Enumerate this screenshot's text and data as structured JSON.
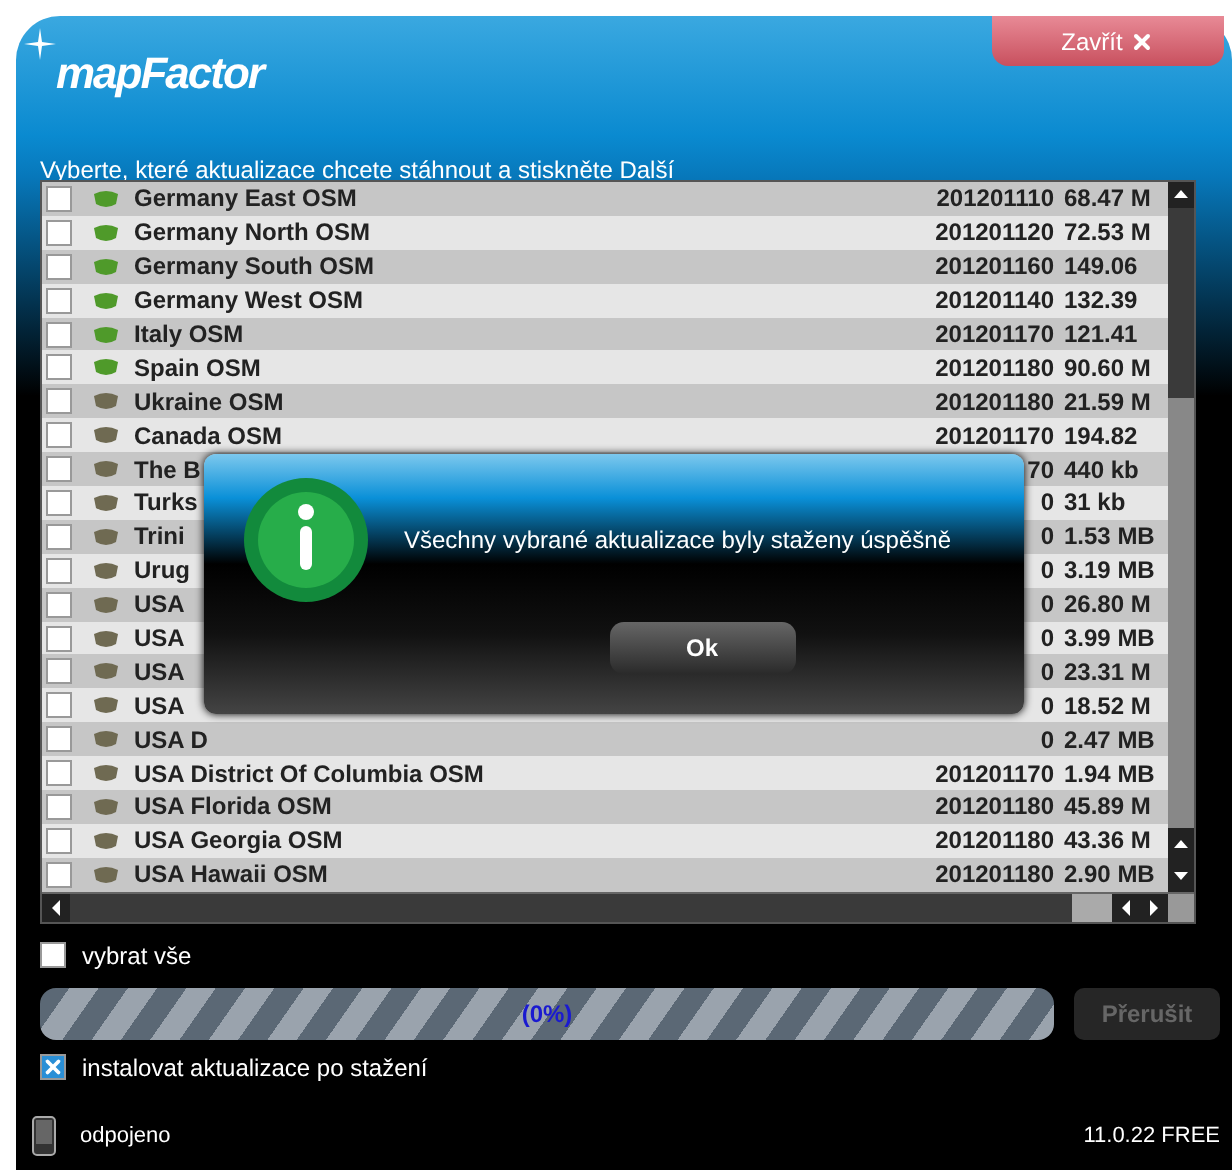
{
  "header": {
    "logo": "mapFactor",
    "close_button": "Zavřít",
    "instruction": "Vyberte, které aktualizace chcete stáhnout a stiskněte Další"
  },
  "updates": [
    {
      "name": "Germany East OSM",
      "date": "201201110",
      "size": "68.47 M",
      "checked": false,
      "installed": true
    },
    {
      "name": "Germany North OSM",
      "date": "201201120",
      "size": "72.53 M",
      "checked": false,
      "installed": true
    },
    {
      "name": "Germany South OSM",
      "date": "201201160",
      "size": "149.06",
      "checked": false,
      "installed": true
    },
    {
      "name": "Germany West OSM",
      "date": "201201140",
      "size": "132.39",
      "checked": false,
      "installed": true
    },
    {
      "name": "Italy OSM",
      "date": "201201170",
      "size": "121.41",
      "checked": false,
      "installed": true
    },
    {
      "name": "Spain OSM",
      "date": "201201180",
      "size": "90.60 M",
      "checked": false,
      "installed": true
    },
    {
      "name": "Ukraine OSM",
      "date": "201201180",
      "size": "21.59 M",
      "checked": false,
      "installed": false
    },
    {
      "name": "Canada OSM",
      "date": "201201170",
      "size": "194.82",
      "checked": false,
      "installed": false
    },
    {
      "name": "The B",
      "date": "70",
      "size": "440 kb",
      "checked": false,
      "installed": false
    },
    {
      "name": "Turks",
      "date": "0",
      "size": "31 kb",
      "checked": false,
      "installed": false
    },
    {
      "name": "Trini",
      "date": "0",
      "size": "1.53 MB",
      "checked": false,
      "installed": false
    },
    {
      "name": "Urug",
      "date": "0",
      "size": "3.19 MB",
      "checked": false,
      "installed": false
    },
    {
      "name": "USA",
      "date": "0",
      "size": "26.80 M",
      "checked": false,
      "installed": false
    },
    {
      "name": "USA",
      "date": "0",
      "size": "3.99 MB",
      "checked": false,
      "installed": false
    },
    {
      "name": "USA",
      "date": "0",
      "size": "23.31 M",
      "checked": false,
      "installed": false
    },
    {
      "name": "USA",
      "date": "0",
      "size": "18.52 M",
      "checked": false,
      "installed": false
    },
    {
      "name": "USA D",
      "date": "0",
      "size": "2.47 MB",
      "checked": false,
      "installed": false
    },
    {
      "name": "USA District Of Columbia OSM",
      "date": "201201170",
      "size": "1.94 MB",
      "checked": false,
      "installed": false
    },
    {
      "name": "USA Florida OSM",
      "date": "201201180",
      "size": "45.89 M",
      "checked": false,
      "installed": false
    },
    {
      "name": "USA Georgia OSM",
      "date": "201201180",
      "size": "43.36 M",
      "checked": false,
      "installed": false
    },
    {
      "name": "USA Hawaii OSM",
      "date": "201201180",
      "size": "2.90 MB",
      "checked": false,
      "installed": false
    }
  ],
  "select_all": {
    "label": "vybrat vše",
    "checked": false
  },
  "progress": {
    "level": 0,
    "reading": "(0%)"
  },
  "cancel_button": {
    "label": "Přerušit",
    "disabled": true
  },
  "install_after": {
    "label": "instalovat aktualizace po stažení",
    "checked": true
  },
  "status": {
    "connection": "odpojeno",
    "version": "11.0.22 FREE"
  },
  "dialog": {
    "message": "Všechny vybrané aktualizace byly staženy úspěšně",
    "ok_button": "Ok"
  }
}
